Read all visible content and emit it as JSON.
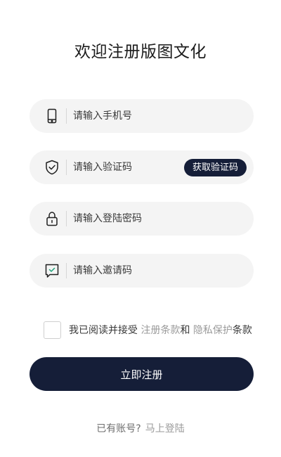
{
  "title": "欢迎注册版图文化",
  "fields": {
    "phone": {
      "placeholder": "请输入手机号",
      "icon": "phone-icon"
    },
    "code": {
      "placeholder": "请输入验证码",
      "icon": "shield-check-icon",
      "button_label": "获取验证码"
    },
    "password": {
      "placeholder": "请输入登陆密码",
      "icon": "lock-icon"
    },
    "invite": {
      "placeholder": "请输入邀请码",
      "icon": "message-check-icon"
    }
  },
  "agreement": {
    "prefix": "我已阅读并接受",
    "terms_link": "注册条款",
    "and": "和",
    "privacy_link": "隐私保护",
    "suffix": "条款",
    "checked": false
  },
  "submit_label": "立即注册",
  "footer": {
    "prompt": "已有账号?",
    "login_link": "马上登陆"
  },
  "colors": {
    "primary": "#151e38",
    "field_bg": "#f4f4f4",
    "icon": "#1f1f1f",
    "icon_accent": "#1fa37a",
    "link": "#9a9a9a"
  }
}
